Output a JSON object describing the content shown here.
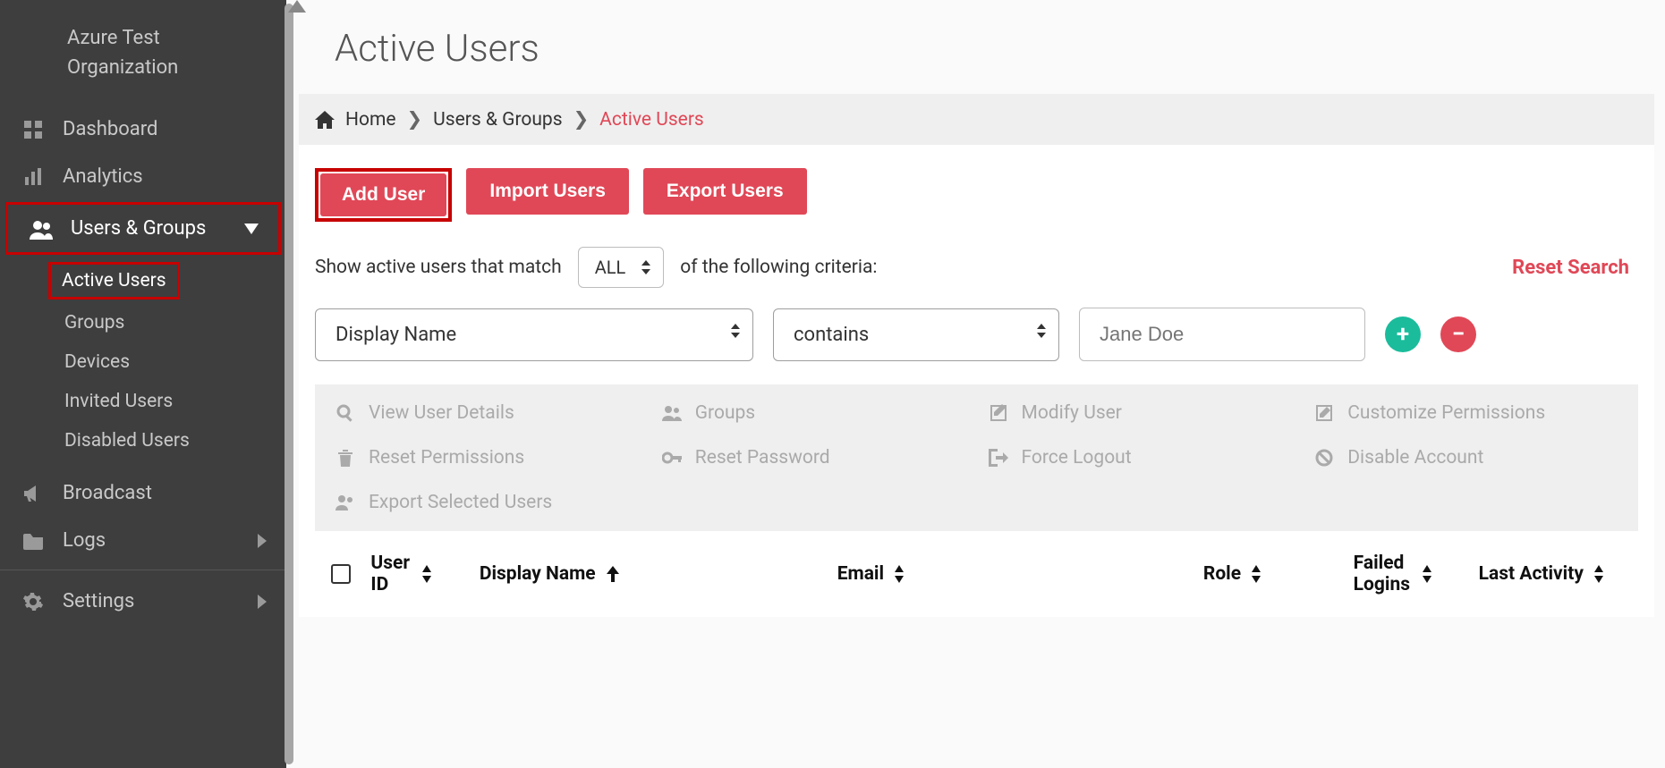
{
  "org": {
    "line1": "Azure Test",
    "line2": "Organization"
  },
  "sidebar": {
    "items": [
      {
        "label": "Dashboard"
      },
      {
        "label": "Analytics"
      },
      {
        "label": "Users & Groups"
      },
      {
        "label": "Broadcast"
      },
      {
        "label": "Logs"
      },
      {
        "label": "Settings"
      }
    ],
    "sub_users_groups": [
      {
        "label": "Active Users"
      },
      {
        "label": "Groups"
      },
      {
        "label": "Devices"
      },
      {
        "label": "Invited Users"
      },
      {
        "label": "Disabled Users"
      }
    ]
  },
  "page": {
    "title": "Active Users"
  },
  "breadcrumb": {
    "home": "Home",
    "mid": "Users & Groups",
    "current": "Active Users"
  },
  "buttons": {
    "add": "Add User",
    "import": "Import Users",
    "export": "Export Users"
  },
  "filter": {
    "prefix": "Show active users that match",
    "mode": "ALL",
    "suffix": "of the following criteria:",
    "reset": "Reset Search",
    "field": "Display Name",
    "operator": "contains",
    "value_placeholder": "Jane Doe"
  },
  "actions": {
    "view": "View User Details",
    "groups": "Groups",
    "modify": "Modify User",
    "custom": "Customize Permissions",
    "reset_perm": "Reset Permissions",
    "reset_pw": "Reset Password",
    "force_logout": "Force Logout",
    "disable": "Disable Account",
    "export_sel": "Export Selected Users"
  },
  "table": {
    "headers": {
      "user_id_l1": "User",
      "user_id_l2": "ID",
      "display_name": "Display Name",
      "email": "Email",
      "role": "Role",
      "failed_l1": "Failed",
      "failed_l2": "Logins",
      "last_activity": "Last Activity"
    }
  }
}
